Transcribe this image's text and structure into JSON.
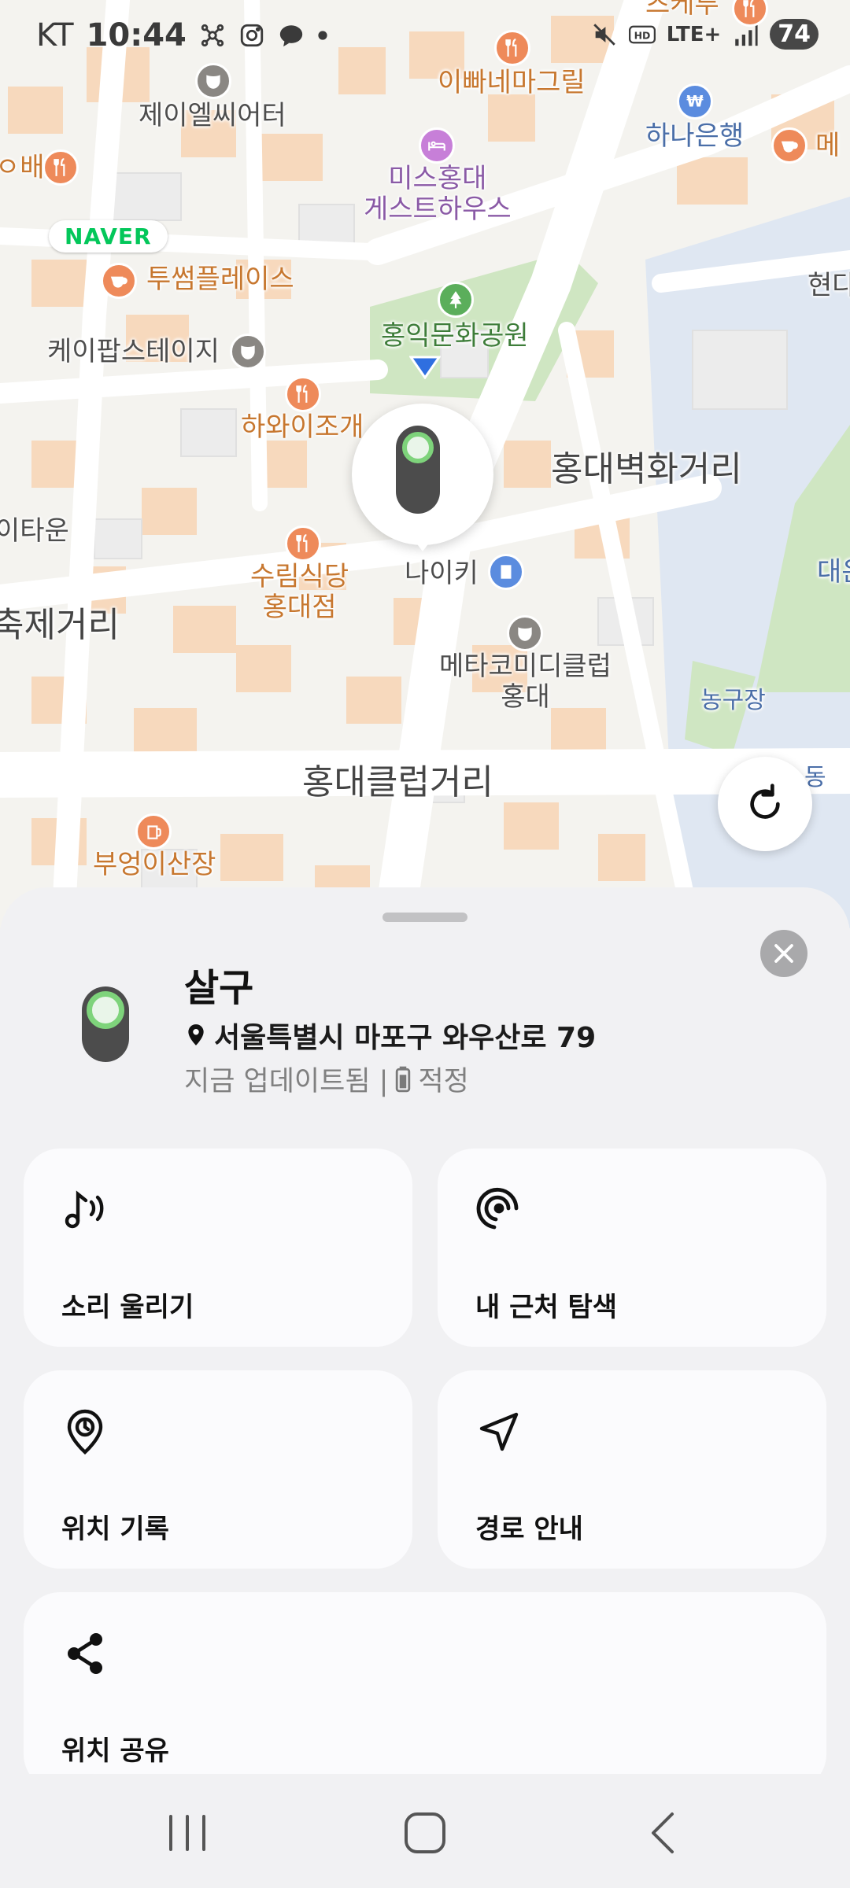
{
  "status_bar": {
    "carrier": "KT",
    "time": "10:44",
    "network": "LTE+",
    "battery": "74"
  },
  "map": {
    "provider_badge": "NAVER",
    "labels": {
      "top_restaurant": "츠케루",
      "cafe_left": "ㅇ배",
      "jelcyeoter": "제이엘씨어터",
      "ippa": "이빠네마그릴",
      "hana": "하나은행",
      "me": "메",
      "misshongdae": "미스홍대\n게스트하우스",
      "twosome": "투썸플레이스",
      "hyundai": "현다",
      "kpop": "케이팝스테이지",
      "park": "홍익문화공원",
      "hawaii": "하와이조개",
      "ataun": "이타운",
      "hongdae_mural": "홍대벽화거리",
      "naiki": "나이키",
      "surim": "수림식당\n홍대점",
      "daeeun": "대은",
      "festival": "축제거리",
      "metacomedy": "메타코미디클럽\n홍대",
      "nongu": "농구장",
      "dong": "동",
      "club_street": "홍대클럽거리",
      "bueong": "부엉이산장"
    }
  },
  "device": {
    "name": "살구",
    "address": "서울특별시 마포구 와우산로 79",
    "updated": "지금 업데이트됨 |",
    "battery_status": "적정"
  },
  "actions": {
    "sound": "소리 울리기",
    "nearby": "내 근처 탐색",
    "history": "위치 기록",
    "route": "경로 안내",
    "share": "위치 공유"
  }
}
